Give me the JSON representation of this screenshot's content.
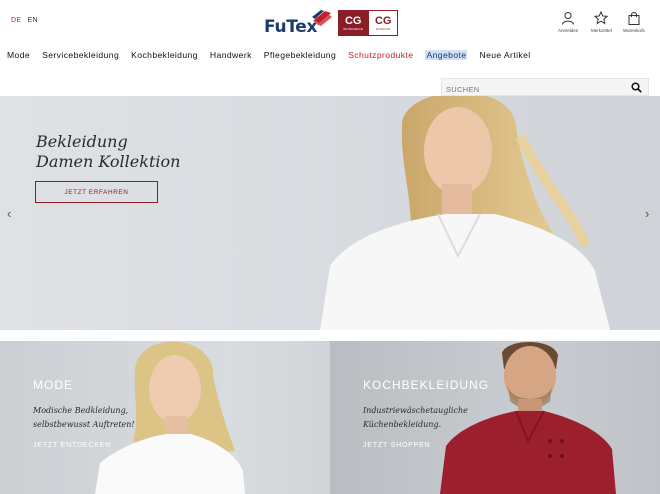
{
  "header": {
    "languages": [
      {
        "code": "DE",
        "active": true
      },
      {
        "code": "EN",
        "active": false
      }
    ],
    "logo": {
      "brand": "FuTex",
      "badge1": {
        "text": "CG",
        "sub": "WORKWEAR"
      },
      "badge2": {
        "text": "CG",
        "sub": "FASHION"
      }
    },
    "actions": [
      {
        "label": "Anmelden",
        "icon": "user-icon"
      },
      {
        "label": "Merkzettel",
        "icon": "star-icon"
      },
      {
        "label": "Warenkorb",
        "icon": "bag-icon"
      }
    ]
  },
  "nav": {
    "items": [
      {
        "label": "Mode"
      },
      {
        "label": "Servicebekleidung"
      },
      {
        "label": "Kochbekleidung"
      },
      {
        "label": "Handwerk"
      },
      {
        "label": "Pflegebekleidung"
      },
      {
        "label": "Schutzprodukte",
        "color": "#c81e2b"
      },
      {
        "label": "Angebote",
        "highlight": true
      },
      {
        "label": "Neue Artikel"
      }
    ]
  },
  "search": {
    "placeholder": "SUCHEN",
    "icon": "search-icon"
  },
  "hero": {
    "title_line1": "Bekleidung",
    "title_line2": "Damen Kollektion",
    "button": "JETZT ERFAHREN",
    "prev_arrow": "‹",
    "next_arrow": "›"
  },
  "tiles": [
    {
      "heading": "MODE",
      "text_line1": "Modische Bedkleidung,",
      "text_line2": "selbstbewusst Auftreten!",
      "link": "JETZT ENTDECKEN"
    },
    {
      "heading": "KOCHBEKLEIDUNG",
      "text_line1": "Industriewäschetaugliche",
      "text_line2": "Küchenbekleidung.",
      "link": "JETZT SHOPPEN"
    }
  ],
  "colors": {
    "brand_red": "#c81e2b",
    "brand_burgundy": "#8a1d28",
    "brand_navy": "#1d3a6a",
    "nav_highlight": "#cfe0f7"
  }
}
